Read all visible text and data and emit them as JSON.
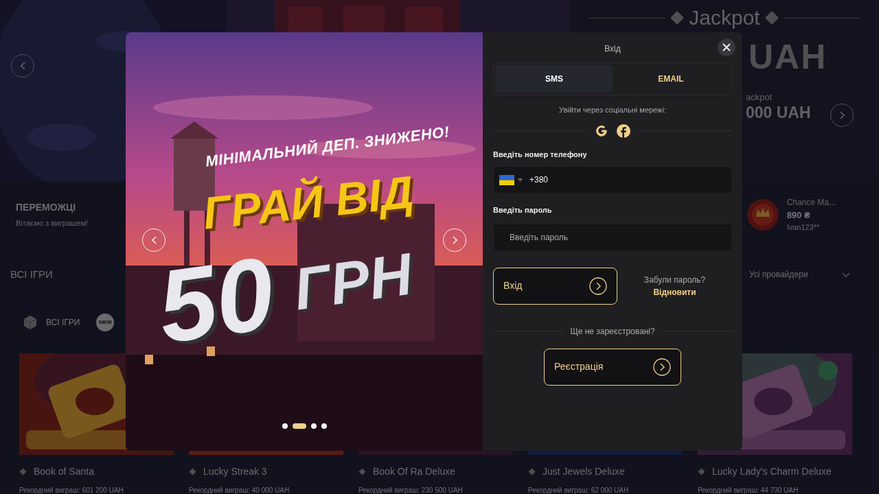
{
  "hero": {
    "jackpot_title": "Jackpot",
    "jackpot_amount": "UAH",
    "secondary_label": "ackpot",
    "secondary_amount": "000 UAH"
  },
  "winners": {
    "title": "ПЕРЕМОЖЦІ",
    "subtitle": "Вітаємо з виграшем!",
    "entries": [
      {
        "game": "Chance Ma...",
        "amount": "890 ₴",
        "user": "Ivan123**"
      }
    ]
  },
  "games_section": {
    "title": "ВСІ ІГРИ",
    "provider_filter": "Усі провайдери",
    "categories": [
      {
        "kind": "dice",
        "label": "ВСІ ІГРИ"
      },
      {
        "kind": "new",
        "label": "NEW"
      }
    ]
  },
  "games": [
    {
      "title": "Book of Santa",
      "record": "Рекордний виграш: 601 200 UAH"
    },
    {
      "title": "Lucky Streak 3",
      "record": "Рекордний виграш: 40 000 UAH"
    },
    {
      "title": "Book Of Ra Deluxe",
      "record": "Рекордний виграш: 230 500 UAH"
    },
    {
      "title": "Just Jewels Deluxe",
      "record": "Рекордний виграш: 62 000 UAH"
    },
    {
      "title": "Lucky Lady's Charm Deluxe",
      "record": "Рекордний виграш: 44 730 UAH"
    }
  ],
  "login_modal": {
    "promo": {
      "tagline": "МІНІМАЛЬНИЙ ДЕП. ЗНИЖЕНО!",
      "headline": "ГРАЙ ВІД",
      "amount": "50",
      "currency": "ГРН",
      "dots": [
        {
          "selected": false
        },
        {
          "selected": true
        },
        {
          "selected": false
        },
        {
          "selected": false
        }
      ]
    },
    "title": "Вхід",
    "tabs": [
      {
        "label": "SMS",
        "selected": true
      },
      {
        "label": "EMAIL",
        "selected": false
      }
    ],
    "social_label": "Увійти через соціальні мережі:",
    "social": [
      {
        "kind": "google"
      },
      {
        "kind": "facebook"
      }
    ],
    "phone_label": "Введіть номер телефону",
    "phone_value": "+380",
    "password_label": "Введіть пароль",
    "password_placeholder": "Введіть пароль",
    "login_button": "Вхід",
    "forgot_text": "Забули пароль?",
    "restore_link": "Відновити",
    "register_prompt": "Ще не зареєстровані?",
    "register_button": "Реєстрація"
  }
}
